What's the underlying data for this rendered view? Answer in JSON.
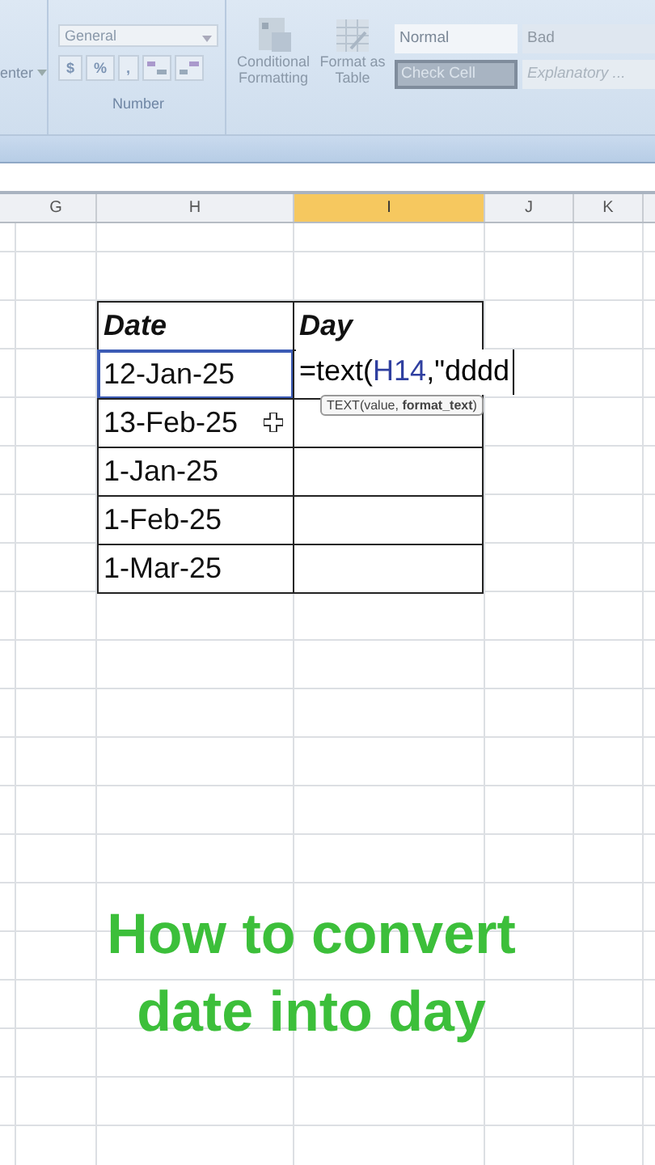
{
  "ribbon": {
    "alignment_partial": "enter",
    "number_format": "General",
    "number_buttons": [
      "$",
      "%",
      ","
    ],
    "number_group": "Number",
    "commands": [
      {
        "label": "Conditional Formatting",
        "kind": "conditional"
      },
      {
        "label": "Format as Table",
        "kind": "table"
      }
    ],
    "styles": [
      {
        "label": "Normal",
        "kind": "normal"
      },
      {
        "label": "Bad",
        "kind": "bad"
      },
      {
        "label": "Check Cell",
        "kind": "check"
      },
      {
        "label": "Explanatory ...",
        "kind": "explanatory"
      }
    ]
  },
  "columns": [
    {
      "label": "G",
      "selected": false
    },
    {
      "label": "H",
      "selected": false
    },
    {
      "label": "I",
      "selected": true
    },
    {
      "label": "J",
      "selected": false
    },
    {
      "label": "K",
      "selected": false
    }
  ],
  "table": {
    "headers": [
      "Date",
      "Day"
    ],
    "rows": [
      {
        "date": "12-Jan-25",
        "selected": true,
        "formula": {
          "function": "=text(",
          "reference": "H14",
          "rest": ",\"dddd"
        }
      },
      {
        "date": "13-Feb-25",
        "selected": false
      },
      {
        "date": "1-Jan-25",
        "selected": false
      },
      {
        "date": "1-Feb-25",
        "selected": false
      },
      {
        "date": "1-Mar-25",
        "selected": false
      }
    ]
  },
  "tooltip": "TEXT(value, **format_text**)",
  "caption": [
    "How to convert",
    "date into day"
  ]
}
